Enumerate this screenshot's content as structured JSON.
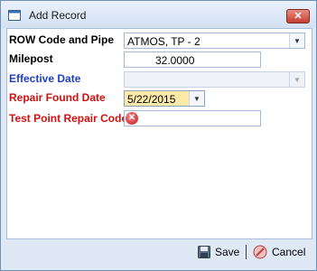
{
  "window": {
    "title": "Add Record",
    "close_glyph": "✕"
  },
  "form": {
    "row_code": {
      "label": "ROW Code and Pipe",
      "value": "ATMOS, TP - 2"
    },
    "milepost": {
      "label": "Milepost",
      "value": "32.0000"
    },
    "effective_date": {
      "label": "Effective Date",
      "value": ""
    },
    "repair_found_date": {
      "label": "Repair Found Date",
      "value": "5/22/2015"
    },
    "test_point_repair_code": {
      "label": "Test Point Repair Code",
      "value": "",
      "error_glyph": "✕"
    }
  },
  "footer": {
    "save_label": "Save",
    "cancel_label": "Cancel"
  },
  "colors": {
    "label_default": "#000000",
    "label_optional": "#2040c0",
    "label_required": "#d01010",
    "date_highlight": "#fdeaa8",
    "window_bg": "#dfe9f6"
  },
  "icons": {
    "app": "window-icon",
    "close": "close-icon",
    "dropdown": "chevron-down-icon",
    "error": "error-icon",
    "save": "floppy-disk-icon",
    "cancel": "cancel-icon"
  }
}
